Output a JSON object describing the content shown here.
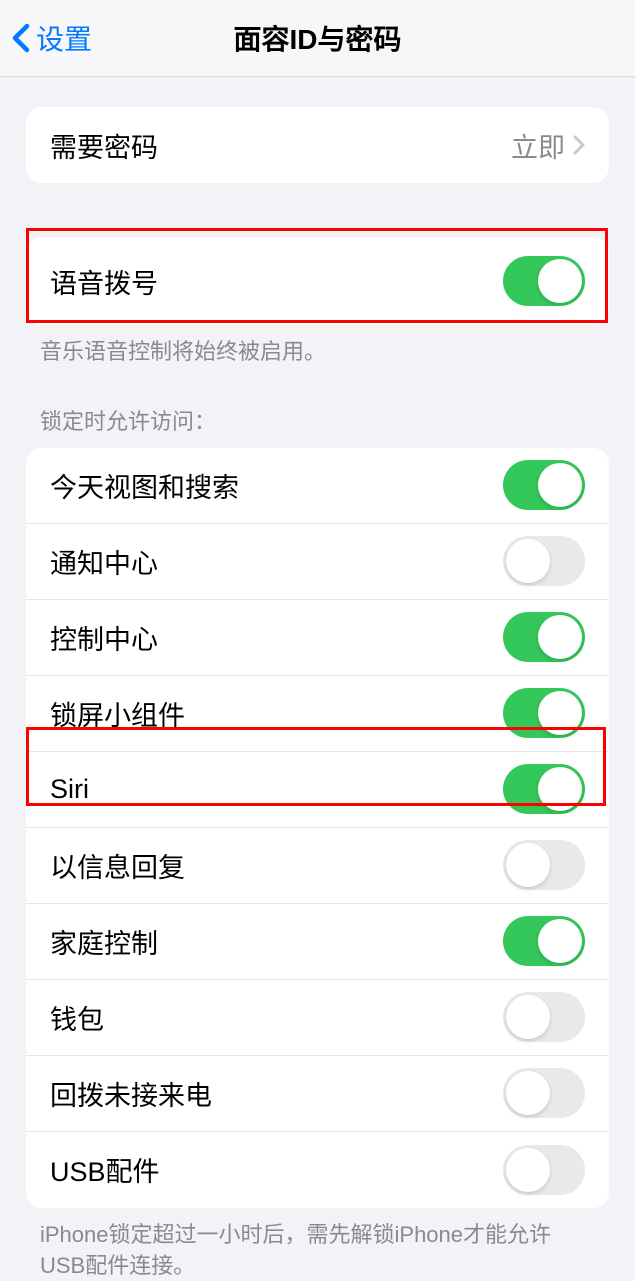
{
  "nav": {
    "back_label": "设置",
    "title": "面容ID与密码"
  },
  "passcode_group": {
    "require_passcode": {
      "label": "需要密码",
      "value": "立即"
    }
  },
  "voice_dial": {
    "label": "语音拨号",
    "enabled": true,
    "footer": "音乐语音控制将始终被启用。"
  },
  "lock_access": {
    "header": "锁定时允许访问：",
    "items": [
      {
        "label": "今天视图和搜索",
        "enabled": true
      },
      {
        "label": "通知中心",
        "enabled": false
      },
      {
        "label": "控制中心",
        "enabled": true
      },
      {
        "label": "锁屏小组件",
        "enabled": true
      },
      {
        "label": "Siri",
        "enabled": true
      },
      {
        "label": "以信息回复",
        "enabled": false
      },
      {
        "label": "家庭控制",
        "enabled": true
      },
      {
        "label": "钱包",
        "enabled": false
      },
      {
        "label": "回拨未接来电",
        "enabled": false
      },
      {
        "label": "USB配件",
        "enabled": false
      }
    ],
    "footer": "iPhone锁定超过一小时后，需先解锁iPhone才能允许USB配件连接。"
  }
}
